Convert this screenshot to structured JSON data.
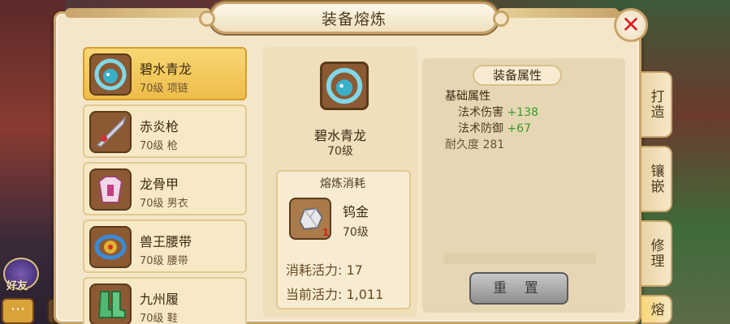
{
  "window": {
    "title": "装备熔炼"
  },
  "side": {
    "friend_label": "好友",
    "chat_icon": "chat-bubble-icon"
  },
  "items": [
    {
      "name": "碧水青龙",
      "level": "70级",
      "type": "项链",
      "selected": true,
      "icon": "dragon-necklace-icon"
    },
    {
      "name": "赤炎枪",
      "level": "70级",
      "type": "枪",
      "selected": false,
      "icon": "spear-icon"
    },
    {
      "name": "龙骨甲",
      "level": "70级",
      "type": "男衣",
      "selected": false,
      "icon": "armor-icon"
    },
    {
      "name": "兽王腰带",
      "level": "70级",
      "type": "腰带",
      "selected": false,
      "icon": "belt-icon"
    },
    {
      "name": "九州履",
      "level": "70级",
      "type": "鞋",
      "selected": false,
      "icon": "boots-icon"
    }
  ],
  "detail": {
    "name": "碧水青龙",
    "level": "70级",
    "cost_title": "熔炼消耗",
    "material_name": "钨金",
    "material_level": "70级",
    "material_count": "1",
    "consume_label": "消耗活力: 17",
    "current_label": "当前活力: 1,011"
  },
  "attributes": {
    "header": "装备属性",
    "section": "基础属性",
    "rows": [
      {
        "label": "法术伤害",
        "value": "+138"
      },
      {
        "label": "法术防御",
        "value": "+67"
      }
    ],
    "durability": "耐久度 281",
    "reset_label": "重 置"
  },
  "tabs": [
    "打造",
    "镶嵌",
    "修理",
    "熔"
  ]
}
